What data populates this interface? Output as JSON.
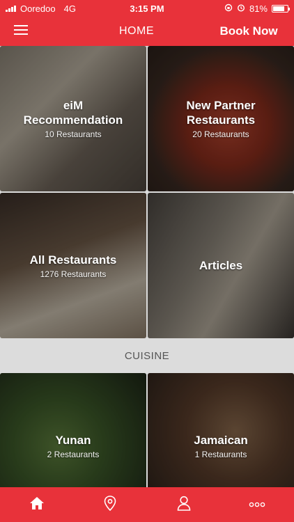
{
  "status_bar": {
    "carrier": "Ooredoo",
    "network": "4G",
    "time": "3:15 PM",
    "battery": "81%",
    "battery_level": 0.81
  },
  "header": {
    "title": "HOME",
    "book_now_label": "Book Now"
  },
  "featured": [
    {
      "title": "eiM Recommendation",
      "count": "10 Restaurants"
    },
    {
      "title": "New Partner Restaurants",
      "count": "20 Restaurants"
    },
    {
      "title": "All Restaurants",
      "count": "1276 Restaurants"
    },
    {
      "title": "Articles",
      "count": ""
    }
  ],
  "cuisine_section": {
    "title": "CUISINE",
    "items": [
      {
        "title": "Yunan",
        "count": "2 Restaurants"
      },
      {
        "title": "Jamaican",
        "count": "1 Restaurants"
      }
    ]
  },
  "tab_bar": {
    "tabs": [
      "home-icon",
      "location-pin-icon",
      "profile-icon",
      "more-icon"
    ]
  },
  "colors": {
    "brand_red": "#e8323a"
  }
}
